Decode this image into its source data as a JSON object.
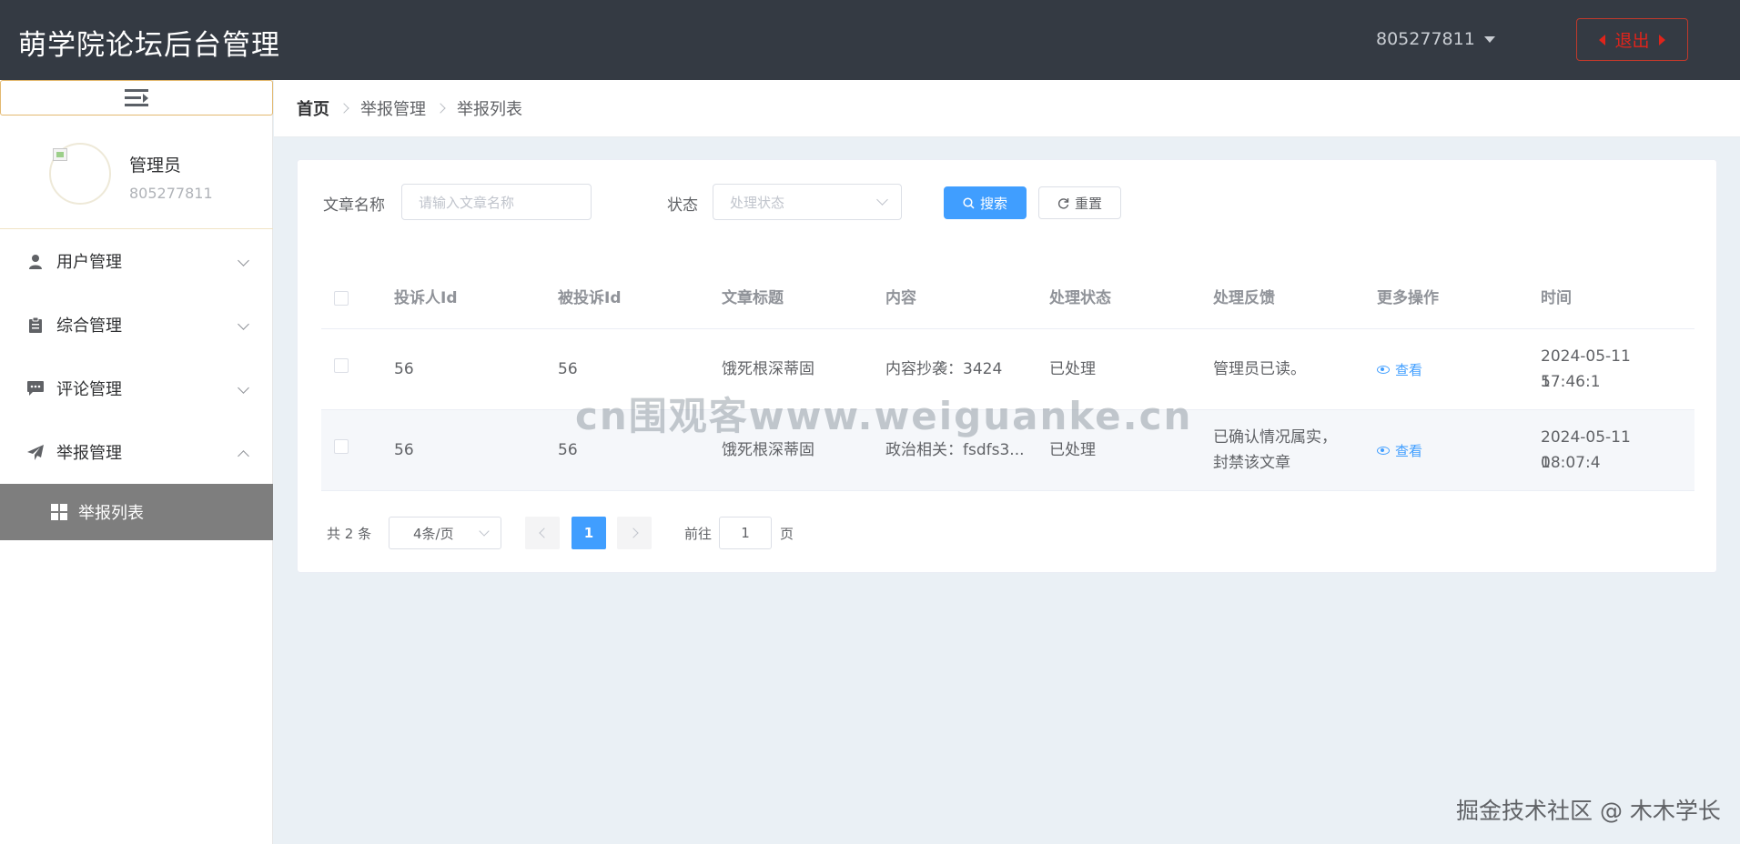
{
  "header": {
    "title": "萌学院论坛后台管理",
    "username": "805277811",
    "logout_label": "退出"
  },
  "sidebar": {
    "collapse_icon": "menu-fold-icon",
    "profile": {
      "role": "管理员",
      "id": "805277811"
    },
    "items": [
      {
        "label": "用户管理",
        "icon": "user-icon",
        "expanded": false
      },
      {
        "label": "综合管理",
        "icon": "clipboard-icon",
        "expanded": false
      },
      {
        "label": "评论管理",
        "icon": "comment-icon",
        "expanded": false
      },
      {
        "label": "举报管理",
        "icon": "send-icon",
        "expanded": true
      }
    ],
    "submenu": {
      "label": "举报列表",
      "icon": "grid-icon",
      "active": true
    }
  },
  "breadcrumb": [
    "首页",
    "举报管理",
    "举报列表"
  ],
  "filters": {
    "title_label": "文章名称",
    "title_placeholder": "请输入文章名称",
    "status_label": "状态",
    "status_placeholder": "处理状态",
    "search_label": "搜索",
    "reset_label": "重置"
  },
  "table": {
    "columns": [
      "投诉人Id",
      "被投诉Id",
      "文章标题",
      "内容",
      "处理状态",
      "处理反馈",
      "更多操作",
      "时间"
    ],
    "rows": [
      {
        "complainant_id": "56",
        "accused_id": "56",
        "article_title": "饿死根深蒂固",
        "content": "内容抄袭：3424",
        "status": "已处理",
        "feedback_1": "管理员已读。",
        "feedback_2": "",
        "action": "查看",
        "time_1": "2024-05-11 17:46:1",
        "time_2": "5"
      },
      {
        "complainant_id": "56",
        "accused_id": "56",
        "article_title": "饿死根深蒂固",
        "content": "政治相关：fsdfs3...",
        "status": "已处理",
        "feedback_1": "已确认情况属实，",
        "feedback_2": "封禁该文章",
        "action": "查看",
        "time_1": "2024-05-11 18:07:4",
        "time_2": "0"
      }
    ]
  },
  "pagination": {
    "total": "共 2 条",
    "page_size": "4条/页",
    "current_page": "1",
    "goto_label": "前往",
    "goto_value": "1",
    "page_suffix": "页"
  },
  "watermarks": {
    "center": "cn围观客www.weiguanke.cn",
    "corner": "掘金技术社区 @ 木木学长"
  },
  "colors": {
    "header_bg": "#343a43",
    "primary": "#409eff",
    "logout_red": "#e0241b",
    "active_menu_bg": "#7e7e7e",
    "page_bg": "#eaf0f5"
  }
}
